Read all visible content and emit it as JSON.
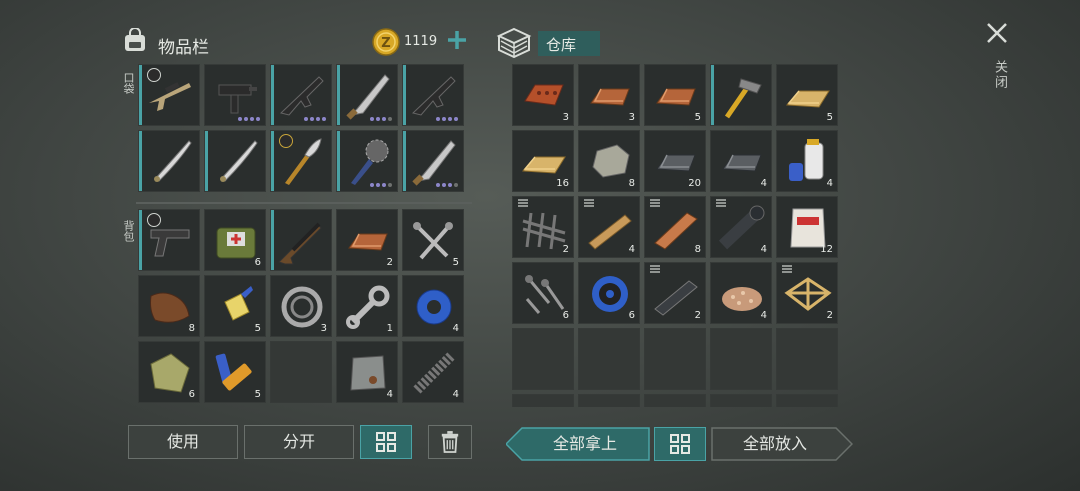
{
  "inventory": {
    "title": "物品栏",
    "coins": "1119",
    "pocket_label": "口袋",
    "backpack_label": "背包",
    "pocket": [
      {
        "icon": "sniper-rifle-icon",
        "qty": "",
        "dots": 0
      },
      {
        "icon": "uzi-icon",
        "qty": "",
        "dots": 4
      },
      {
        "icon": "assault-rifle-icon",
        "qty": "",
        "dots": 4
      },
      {
        "icon": "machete-icon",
        "qty": "",
        "dots": 3
      },
      {
        "icon": "assault-rifle-icon",
        "qty": "",
        "dots": 4
      },
      {
        "icon": "katana-icon",
        "qty": "",
        "dots": 0
      },
      {
        "icon": "katana-icon",
        "qty": "",
        "dots": 0
      },
      {
        "icon": "glaive-icon",
        "qty": "",
        "dots": 0
      },
      {
        "icon": "spiked-club-icon",
        "qty": "",
        "dots": 3
      },
      {
        "icon": "machete-icon",
        "qty": "",
        "dots": 3
      }
    ],
    "backpack": [
      {
        "icon": "pistol-icon",
        "qty": ""
      },
      {
        "icon": "medkit-bag-icon",
        "qty": "6"
      },
      {
        "icon": "shotgun-icon",
        "qty": ""
      },
      {
        "icon": "copper-ingot-icon",
        "qty": "2"
      },
      {
        "icon": "nails-icon",
        "qty": "5"
      },
      {
        "icon": "leather-icon",
        "qty": "8"
      },
      {
        "icon": "glue-icon",
        "qty": "5"
      },
      {
        "icon": "bearing-icon",
        "qty": "3"
      },
      {
        "icon": "wrench-icon",
        "qty": "1"
      },
      {
        "icon": "tape-icon",
        "qty": "4"
      },
      {
        "icon": "cloth-icon",
        "qty": "6"
      },
      {
        "icon": "batteries-icon",
        "qty": "5"
      },
      {
        "icon": "",
        "qty": ""
      },
      {
        "icon": "metal-plate-icon",
        "qty": "4"
      },
      {
        "icon": "spring-icon",
        "qty": "4"
      }
    ],
    "buttons": {
      "use": "使用",
      "split": "分开"
    }
  },
  "storage": {
    "title": "仓库",
    "items": [
      {
        "icon": "brick-icon",
        "qty": "3"
      },
      {
        "icon": "copper-ingot-icon",
        "qty": "3"
      },
      {
        "icon": "copper-ingot-icon",
        "qty": "5"
      },
      {
        "icon": "hammer-icon",
        "qty": ""
      },
      {
        "icon": "wood-plank-icon",
        "qty": "5"
      },
      {
        "icon": "wood-plank-icon",
        "qty": "16"
      },
      {
        "icon": "stone-icon",
        "qty": "8"
      },
      {
        "icon": "iron-ingot-icon",
        "qty": "20"
      },
      {
        "icon": "iron-ingot-icon",
        "qty": "4"
      },
      {
        "icon": "resin-bottles-icon",
        "qty": "4"
      },
      {
        "icon": "rebar-mesh-icon",
        "qty": "2"
      },
      {
        "icon": "wood-beam-icon",
        "qty": "4"
      },
      {
        "icon": "copper-bar-icon",
        "qty": "8"
      },
      {
        "icon": "pipe-icon",
        "qty": "4"
      },
      {
        "icon": "cement-bag-icon",
        "qty": "12"
      },
      {
        "icon": "screws-icon",
        "qty": "6"
      },
      {
        "icon": "wire-spool-icon",
        "qty": "6"
      },
      {
        "icon": "steel-bar-icon",
        "qty": "2"
      },
      {
        "icon": "gravel-icon",
        "qty": "4"
      },
      {
        "icon": "wood-frame-icon",
        "qty": "2"
      }
    ],
    "buttons": {
      "take_all": "全部拿上",
      "put_all": "全部放入"
    }
  },
  "close_label": "关闭",
  "colors": {
    "accent": "#4aa3a6",
    "teal_button": "#2e6a68",
    "slot": "#2a2e2d"
  }
}
